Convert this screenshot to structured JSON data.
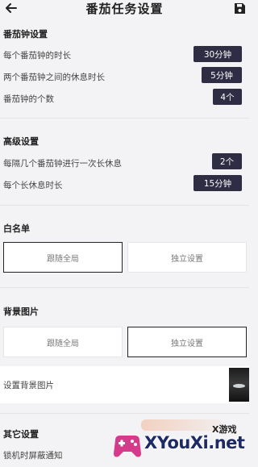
{
  "header": {
    "title": "番茄任务设置",
    "back_icon": "back-arrow-icon",
    "save_icon": "save-icon"
  },
  "pomodoro": {
    "title": "番茄钟设置",
    "rows": [
      {
        "label": "每个番茄钟的时长",
        "value": "30分钟"
      },
      {
        "label": "两个番茄钟之间的休息时长",
        "value": "5分钟"
      },
      {
        "label": "番茄钟的个数",
        "value": "4个"
      }
    ]
  },
  "advanced": {
    "title": "高级设置",
    "rows": [
      {
        "label": "每隔几个番茄钟进行一次长休息",
        "value": "2个"
      },
      {
        "label": "每个长休息时长",
        "value": "15分钟"
      }
    ]
  },
  "whitelist": {
    "title": "白名单",
    "options": [
      "跟随全局",
      "独立设置"
    ],
    "selected": "跟随全局"
  },
  "background": {
    "title": "背景图片",
    "options": [
      "跟随全局",
      "独立设置"
    ],
    "selected": "独立设置",
    "set_label": "设置背景图片"
  },
  "other": {
    "title": "其它设置",
    "rows": [
      {
        "label": "锁机时屏蔽通知"
      }
    ]
  },
  "watermark": {
    "top_text": "X游戏",
    "main_text": "XYouXi.net"
  },
  "colors": {
    "pill_bg": "#2e2d44",
    "page_bg": "#f3f3f5"
  }
}
